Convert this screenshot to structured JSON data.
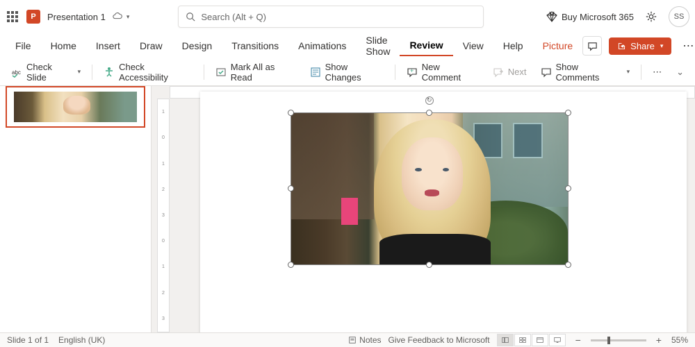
{
  "title": {
    "doc_name": "Presentation 1",
    "search_placeholder": "Search (Alt + Q)",
    "buy365": "Buy Microsoft 365",
    "avatar_initials": "SS"
  },
  "tabs": {
    "file": "File",
    "home": "Home",
    "insert": "Insert",
    "draw": "Draw",
    "design": "Design",
    "transitions": "Transitions",
    "animations": "Animations",
    "slideshow": "Slide Show",
    "review": "Review",
    "view": "View",
    "help": "Help",
    "picture": "Picture"
  },
  "ribbon_right": {
    "share": "Share"
  },
  "commands": {
    "check_slide": "Check Slide",
    "check_accessibility": "Check Accessibility",
    "mark_read": "Mark All as Read",
    "show_changes": "Show Changes",
    "new_comment": "New Comment",
    "next": "Next",
    "show_comments": "Show Comments"
  },
  "status": {
    "slide_counter": "Slide 1 of 1",
    "language": "English (UK)",
    "notes": "Notes",
    "feedback": "Give Feedback to Microsoft",
    "zoom": "55%"
  },
  "ruler_v": [
    "1",
    "0",
    "1",
    "2",
    "3",
    "0",
    "1",
    "2",
    "3"
  ]
}
